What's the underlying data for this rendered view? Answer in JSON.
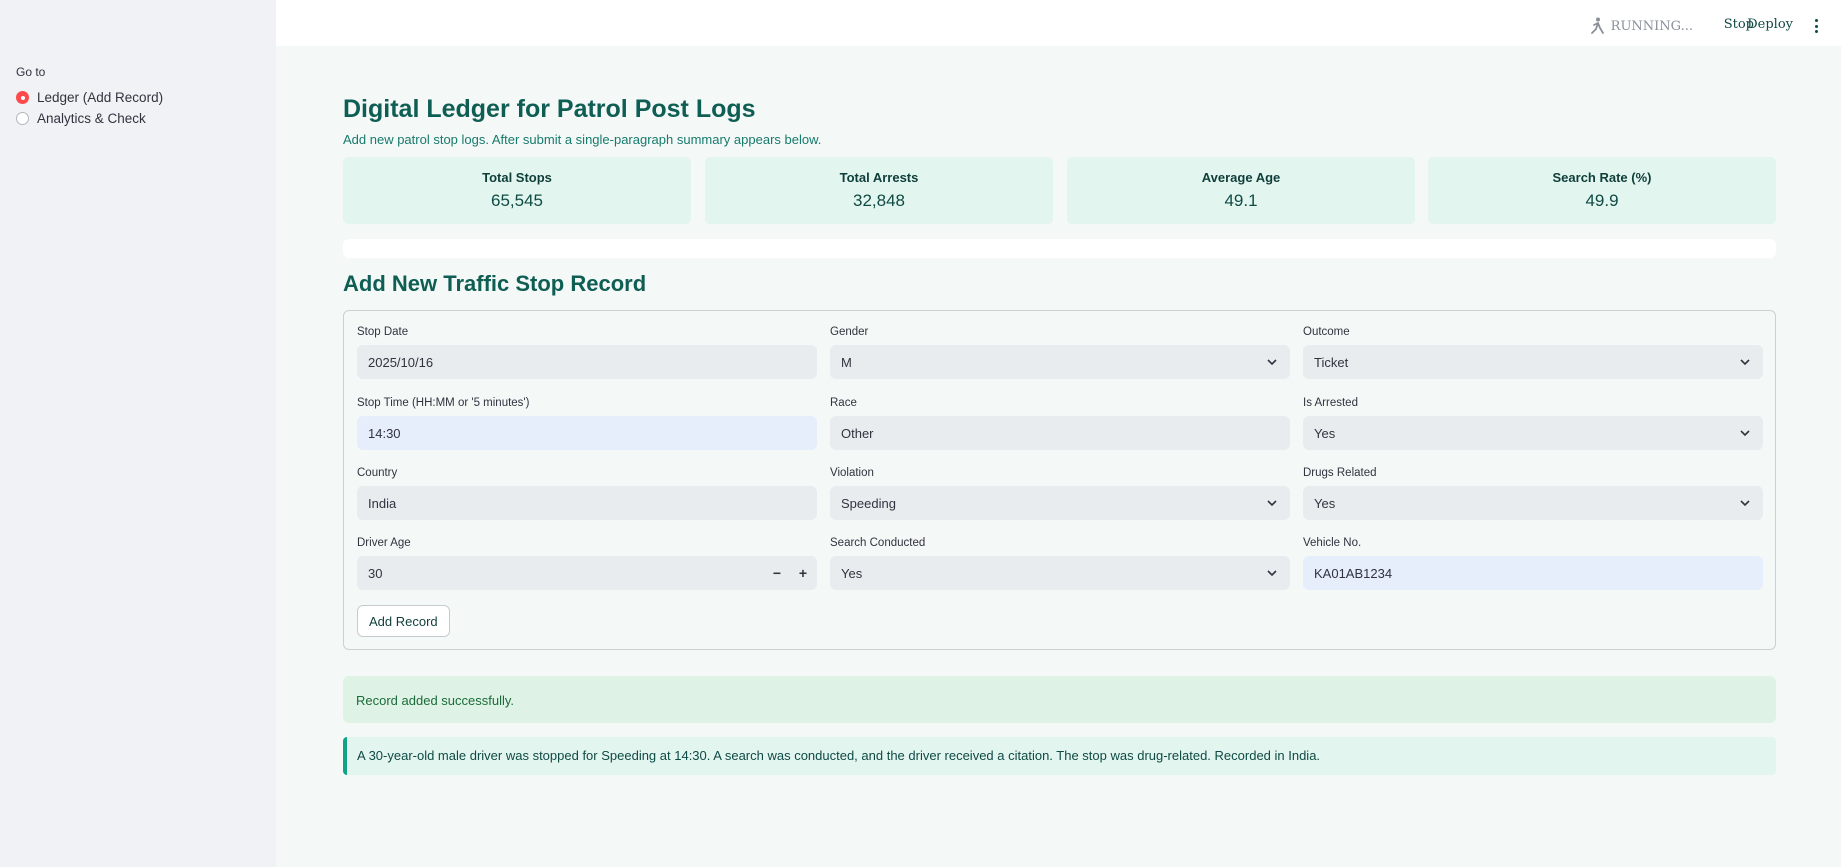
{
  "sidebar": {
    "goto_label": "Go to",
    "options": [
      {
        "label": "Ledger (Add Record)",
        "selected": true
      },
      {
        "label": "Analytics & Check",
        "selected": false
      }
    ]
  },
  "topbar": {
    "status": "RUNNING...",
    "stop": "Stop",
    "deploy": "Deploy",
    "menu_icon": "kebab-menu-icon"
  },
  "header": {
    "title": "Digital Ledger for Patrol Post Logs",
    "subtitle": "Add new patrol stop logs. After submit a single-paragraph summary appears below."
  },
  "metrics": [
    {
      "label": "Total Stops",
      "value": "65,545"
    },
    {
      "label": "Total Arrests",
      "value": "32,848"
    },
    {
      "label": "Average Age",
      "value": "49.1"
    },
    {
      "label": "Search Rate (%)",
      "value": "49.9"
    }
  ],
  "form": {
    "title": "Add New Traffic Stop Record",
    "stop_date": {
      "label": "Stop Date",
      "value": "2025/10/16"
    },
    "gender": {
      "label": "Gender",
      "value": "M"
    },
    "outcome": {
      "label": "Outcome",
      "value": "Ticket"
    },
    "stop_time": {
      "label": "Stop Time (HH:MM or '5 minutes')",
      "value": "14:30"
    },
    "race": {
      "label": "Race",
      "value": "Other"
    },
    "is_arrested": {
      "label": "Is Arrested",
      "value": "Yes"
    },
    "country": {
      "label": "Country",
      "value": "India"
    },
    "violation": {
      "label": "Violation",
      "value": "Speeding"
    },
    "drugs_related": {
      "label": "Drugs Related",
      "value": "Yes"
    },
    "driver_age": {
      "label": "Driver Age",
      "value": "30",
      "minus": "−",
      "plus": "+"
    },
    "search_conducted": {
      "label": "Search Conducted",
      "value": "Yes"
    },
    "vehicle_no": {
      "label": "Vehicle No.",
      "value": "KA01AB1234"
    },
    "submit": "Add Record"
  },
  "messages": {
    "success": "Record added successfully.",
    "summary": "A 30-year-old male driver was stopped for Speeding at 14:30. A search was conducted, and the driver received a citation. The stop was drug-related. Recorded in India."
  },
  "colors": {
    "accent": "#0f5e54",
    "radio_selected": "#ff4b4b",
    "success_bg": "#def3e6",
    "metric_bg": "#e3f5ef"
  }
}
